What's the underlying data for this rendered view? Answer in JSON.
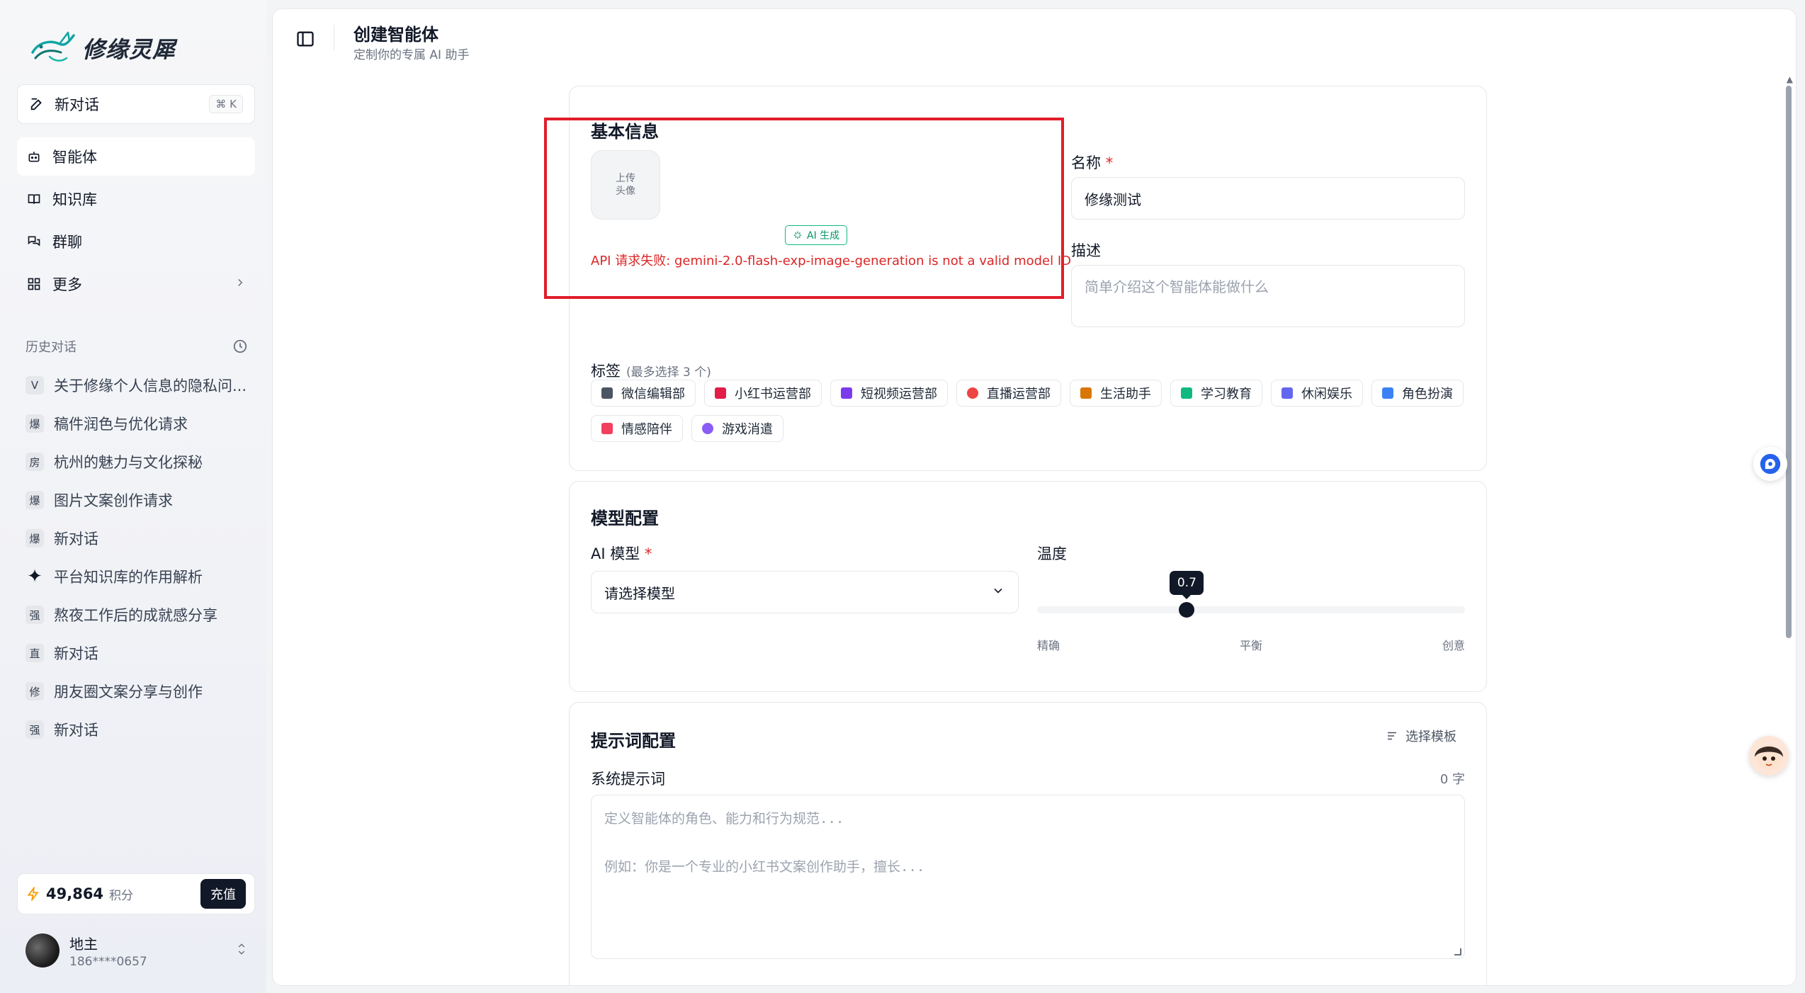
{
  "sidebar": {
    "logo_text": "修缘灵犀",
    "new_chat": {
      "label": "新对话",
      "shortcut": "⌘ K"
    },
    "nav": [
      {
        "label": "智能体",
        "icon": "bot-icon",
        "active": true
      },
      {
        "label": "知识库",
        "icon": "book-icon",
        "active": false
      },
      {
        "label": "群聊",
        "icon": "chat-bubbles-icon",
        "active": false
      },
      {
        "label": "更多",
        "icon": "grid-icon",
        "active": false
      }
    ],
    "history_title": "历史对话",
    "history": [
      {
        "badge": "V",
        "label": "关于修缘个人信息的隐私问..."
      },
      {
        "badge": "爆",
        "label": "稿件润色与优化请求"
      },
      {
        "badge": "房",
        "label": "杭州的魅力与文化探秘"
      },
      {
        "badge": "爆",
        "label": "图片文案创作请求"
      },
      {
        "badge": "爆",
        "label": "新对话"
      },
      {
        "badge": "✦",
        "label": "平台知识库的作用解析"
      },
      {
        "badge": "强",
        "label": "熬夜工作后的成就感分享"
      },
      {
        "badge": "直",
        "label": "新对话"
      },
      {
        "badge": "修",
        "label": "朋友圈文案分享与创作"
      },
      {
        "badge": "强",
        "label": "新对话"
      }
    ],
    "points": {
      "value": "49,864",
      "unit": "积分",
      "recharge": "充值"
    },
    "user": {
      "name": "地主",
      "phone": "186****0657"
    }
  },
  "header": {
    "title": "创建智能体",
    "subtitle": "定制你的专属 AI 助手"
  },
  "basic": {
    "title": "基本信息",
    "upload_line1": "上传",
    "upload_line2": "头像",
    "ai_generate": "AI 生成",
    "error": "API 请求失败: gemini-2.0-flash-exp-image-generation is not a valid model ID",
    "name_label": "名称",
    "required_mark": "*",
    "name_value": "修缘测试",
    "desc_label": "描述",
    "desc_placeholder": "简单介绍这个智能体能做什么",
    "tags_label": "标签",
    "tags_hint": "(最多选择 3 个)",
    "tags": [
      {
        "label": "微信编辑部",
        "color": "#4b5563"
      },
      {
        "label": "小红书运营部",
        "color": "#e11d48"
      },
      {
        "label": "短视频运营部",
        "color": "#7c3aed"
      },
      {
        "label": "直播运营部",
        "color": "#ef4444"
      },
      {
        "label": "生活助手",
        "color": "#d97706"
      },
      {
        "label": "学习教育",
        "color": "#10b981"
      },
      {
        "label": "休闲娱乐",
        "color": "#6366f1"
      },
      {
        "label": "角色扮演",
        "color": "#3b82f6"
      },
      {
        "label": "情感陪伴",
        "color": "#f43f5e"
      },
      {
        "label": "游戏消遣",
        "color": "#8b5cf6"
      }
    ]
  },
  "model": {
    "title": "模型配置",
    "model_label": "AI 模型",
    "required_mark": "*",
    "model_placeholder": "请选择模型",
    "temp_label": "温度",
    "temp_value": "0.7",
    "temp_fraction": 0.35,
    "marks": [
      "精确",
      "平衡",
      "创意"
    ]
  },
  "prompt": {
    "title": "提示词配置",
    "template_button": "选择模板",
    "system_label": "系统提示词",
    "char_count": "0 字",
    "placeholder_line1": "定义智能体的角色、能力和行为规范...",
    "placeholder_line2": "例如：你是一个专业的小红书文案创作助手，擅长..."
  }
}
